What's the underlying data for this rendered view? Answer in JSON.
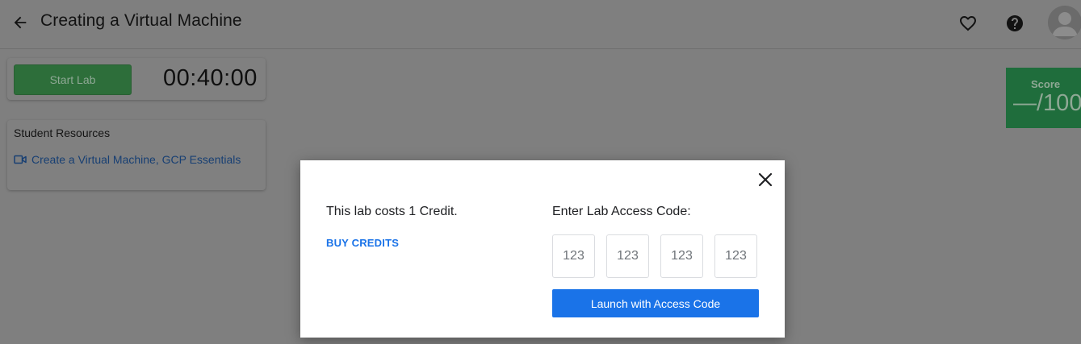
{
  "header": {
    "title": "Creating a Virtual Machine",
    "back_icon": "arrow-back-icon",
    "favorite_icon": "heart-outline-icon",
    "help_icon": "help-circle-icon",
    "avatar_icon": "account-avatar-icon"
  },
  "lab": {
    "start_label": "Start Lab",
    "timer": "00:40:00"
  },
  "resources": {
    "title": "Student Resources",
    "link_label": "Create a Virtual Machine, GCP Essentials",
    "link_icon": "video-camera-icon"
  },
  "score": {
    "label": "Score",
    "value": "—/100"
  },
  "modal": {
    "cost_text": "This lab costs 1 Credit.",
    "buy_label": "BUY CREDITS",
    "code_label": "Enter Lab Access Code:",
    "code_placeholders": [
      "123",
      "123",
      "123",
      "123"
    ],
    "launch_label": "Launch with Access Code",
    "close_icon": "close-icon"
  },
  "colors": {
    "overlay_background": "#7f7f7f",
    "primary_blue": "#1a73e8",
    "start_button_green": "#2d6e3a",
    "score_green": "#1f6d3c"
  }
}
